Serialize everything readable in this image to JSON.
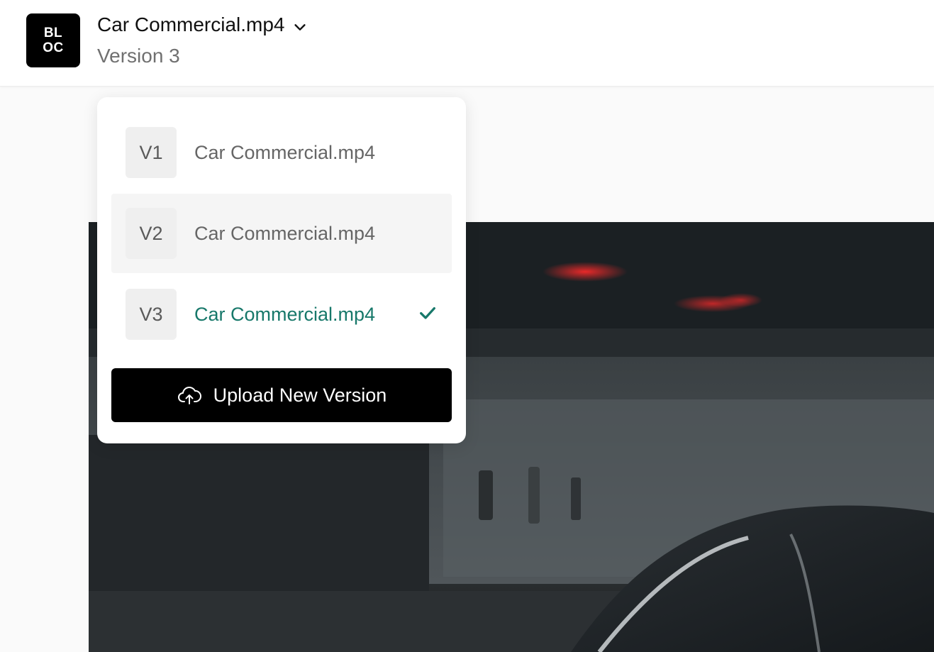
{
  "header": {
    "logo_line1": "BL",
    "logo_line2": "OC",
    "file_title": "Car Commercial.mp4",
    "version_subtitle": "Version 3"
  },
  "dropdown": {
    "versions": [
      {
        "badge": "V1",
        "name": "Car Commercial.mp4",
        "selected": false
      },
      {
        "badge": "V2",
        "name": "Car Commercial.mp4",
        "selected": false
      },
      {
        "badge": "V3",
        "name": "Car Commercial.mp4",
        "selected": true
      }
    ],
    "upload_label": "Upload New Version"
  },
  "colors": {
    "accent_active": "#17786a",
    "button_bg": "#000000",
    "badge_bg": "#efefef"
  },
  "icons": {
    "title_toggle": "chevron-down-icon",
    "selected_marker": "checkmark-icon",
    "upload": "cloud-upload-icon"
  }
}
